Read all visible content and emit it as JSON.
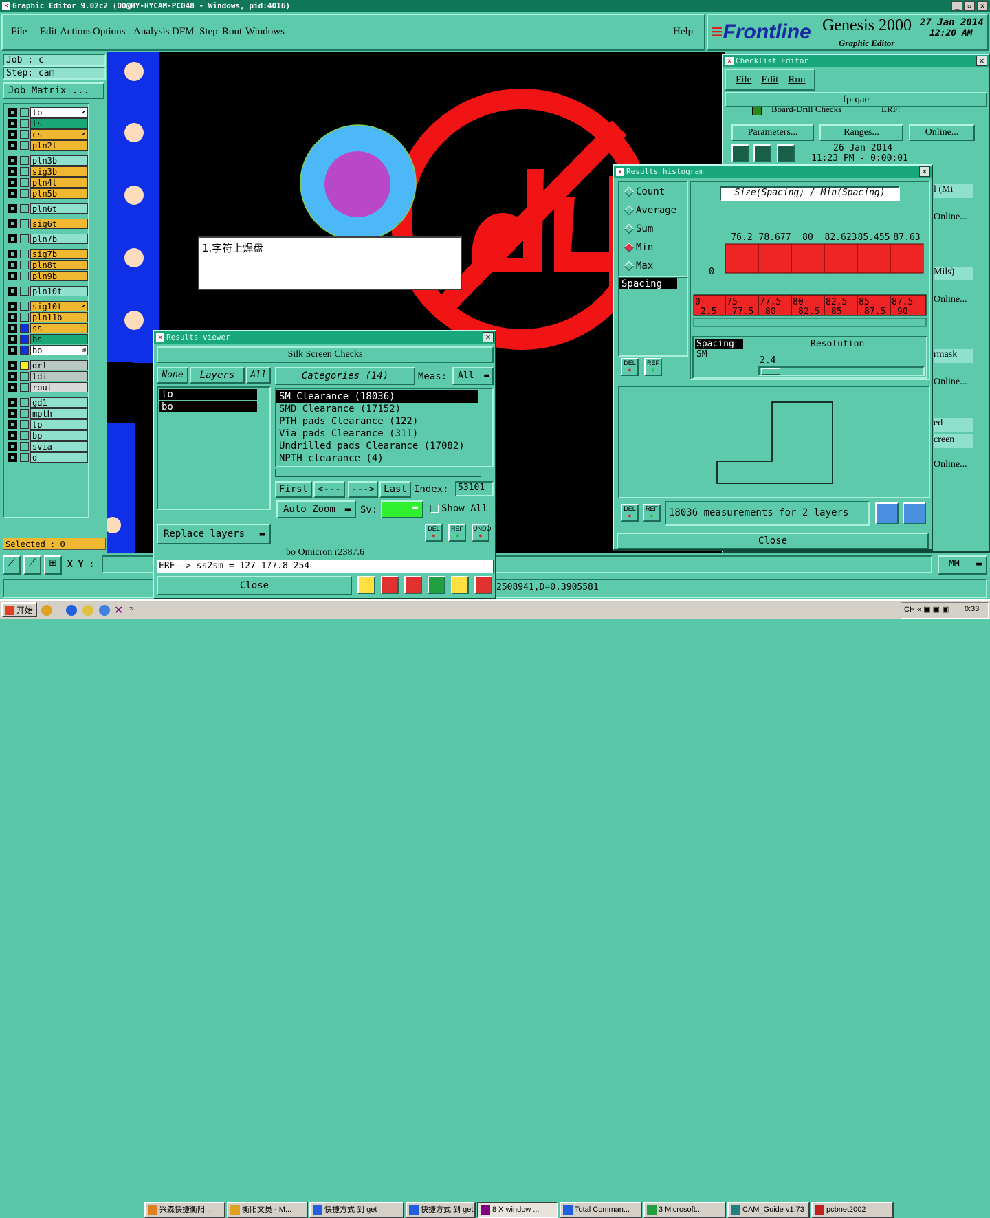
{
  "window_title": "Graphic Editor 9.02c2 (OO@HY-HYCAM-PC048 - Windows, pid:4016)",
  "menu": [
    "File",
    "Edit",
    "Actions",
    "Options",
    "Analysis",
    "DFM",
    "Step",
    "Rout",
    "Windows"
  ],
  "help": "Help",
  "brand": {
    "logo": "Frontline",
    "product": "Genesis 2000",
    "sub": "Graphic Editor",
    "date": "27 Jan 2014",
    "time": "12:20 AM"
  },
  "job": {
    "job": "Job : c",
    "step": "Step: cam",
    "matrix": "Job Matrix ..."
  },
  "layers": [
    {
      "name": "to",
      "color": "#ffffff",
      "mark": "⬋"
    },
    {
      "name": "ts",
      "color": "#1aa878",
      "mark": ""
    },
    {
      "name": "cs",
      "color": "#f0b830",
      "mark": "⬋"
    },
    {
      "name": "pln2t",
      "color": "#f0b830",
      "mark": ""
    },
    {
      "name": "pln3b",
      "color": "#8fe0cc",
      "mark": ""
    },
    {
      "name": "sig3b",
      "color": "#f0b830",
      "mark": ""
    },
    {
      "name": "pln4t",
      "color": "#f0b830",
      "mark": ""
    },
    {
      "name": "pln5b",
      "color": "#f0b830",
      "mark": ""
    },
    {
      "name": "pln6t",
      "color": "#8fe0cc",
      "mark": ""
    },
    {
      "name": "sig6t",
      "color": "#f0b830",
      "mark": ""
    },
    {
      "name": "pln7b",
      "color": "#8fe0cc",
      "mark": ""
    },
    {
      "name": "sig7b",
      "color": "#f0b830",
      "mark": ""
    },
    {
      "name": "pln8t",
      "color": "#f0b830",
      "mark": ""
    },
    {
      "name": "pln9b",
      "color": "#f0b830",
      "mark": ""
    },
    {
      "name": "pln10t",
      "color": "#8fe0cc",
      "mark": ""
    },
    {
      "name": "sig10t",
      "color": "#f0b830",
      "mark": "⬋"
    },
    {
      "name": "pln11b",
      "color": "#f0b830",
      "mark": ""
    },
    {
      "name": "ss",
      "color": "#f0b830",
      "mark": ""
    },
    {
      "name": "bs",
      "color": "#1aa878",
      "mark": ""
    },
    {
      "name": "bo",
      "color": "#ffffff",
      "mark": "⊞"
    },
    {
      "name": "drl",
      "color": "#b8c8c0",
      "mark": ""
    },
    {
      "name": "ldi",
      "color": "#b8c8c0",
      "mark": ""
    },
    {
      "name": "rout",
      "color": "#d8d8d8",
      "mark": ""
    },
    {
      "name": "gd1",
      "color": "#8fe0cc",
      "mark": ""
    },
    {
      "name": "mpth",
      "color": "#8fe0cc",
      "mark": ""
    },
    {
      "name": "tp",
      "color": "#8fe0cc",
      "mark": ""
    },
    {
      "name": "bp",
      "color": "#8fe0cc",
      "mark": ""
    },
    {
      "name": "svia",
      "color": "#8fe0cc",
      "mark": ""
    },
    {
      "name": "d",
      "color": "#8fe0cc",
      "mark": ""
    }
  ],
  "selected": "Selected : 0",
  "xy_label": "X Y :",
  "annotation": "1.字符上焊盘",
  "status_line": "2508941,D=0.3905581",
  "units": "MM",
  "checklist": {
    "title": "Checklist Editor",
    "menu": [
      "File",
      "Edit",
      "Run"
    ],
    "name": "fp-qae",
    "row": "Board-Drill Checks",
    "erf": "ERF:",
    "buttons": [
      "Parameters...",
      "Ranges...",
      "Online..."
    ],
    "date": "26 Jan 2014",
    "time": "11:23 PM - 0:00:01",
    "side": [
      "l (Mi",
      "Online...",
      "Mils)",
      "Online...",
      "rmask",
      "Online...",
      "ed",
      "creen",
      "Online..."
    ]
  },
  "results_viewer": {
    "title": "Results viewer",
    "heading": "Silk Screen Checks",
    "none": "None",
    "layers_lbl": "Layers",
    "all": "All",
    "layers": [
      "to",
      "bo"
    ],
    "categories_lbl": "Categories (14)",
    "meas_lbl": "Meas:",
    "meas_val": "All",
    "categories": [
      "SM Clearance (18036)",
      "SMD Clearance (17152)",
      "PTH pads Clearance (122)",
      "Via pads Clearance (311)",
      "Undrilled pads Clearance (17082)",
      "NPTH clearance (4)"
    ],
    "nav": [
      "First",
      "<---",
      "--->",
      "Last"
    ],
    "index_lbl": "Index:",
    "index_val": "53101",
    "auto_zoom": "Auto Zoom",
    "sv_lbl": "Sv:",
    "show_all": "Show All",
    "replace": "Replace layers",
    "del": "DEL",
    "ref": "REF",
    "undo": "UNDO",
    "info": "bo Omicron  r2387.6",
    "erf": "ERF--> ss2sm = 127 177.8 254",
    "close": "Close"
  },
  "histogram": {
    "title": "Results histogram",
    "modes": [
      "Count",
      "Average",
      "Sum",
      "Min",
      "Max"
    ],
    "selected_mode": "Min",
    "measure_list": [
      "Spacing"
    ],
    "chart_title": "Size(Spacing) / Min(Spacing)",
    "del": "DEL",
    "ref": "REF",
    "resolution_lbl": "Resolution",
    "res_list": [
      "Spacing",
      "SM"
    ],
    "res_value": "2.4",
    "summary": "18036 measurements for 2 layers",
    "close": "Close"
  },
  "chart_data": {
    "type": "bar",
    "title": "Size(Spacing) / Min(Spacing)",
    "categories": [
      "0-2.5",
      "75-77.5",
      "77.5-80",
      "80-82.5",
      "82.5-85",
      "85-87.5",
      "87.5-90"
    ],
    "values": [
      0,
      76.2,
      78.677,
      80,
      82.623,
      85.455,
      87.63
    ],
    "labels": [
      "0",
      "76.2",
      "78.677",
      "80",
      "82.623",
      "85.455",
      "87.63"
    ],
    "ylim": [
      0,
      90
    ]
  },
  "taskbar": {
    "start": "开始",
    "items": [
      "兴森快捷衡阳...",
      "衡阳文员 - M...",
      "快捷方式 到 get",
      "快捷方式 到 get",
      "8 X window ...",
      "Total Comman...",
      "3 Microsoft...",
      "CAM_Guide v1.73",
      "pcbnet2002"
    ],
    "clock": "0:33"
  }
}
